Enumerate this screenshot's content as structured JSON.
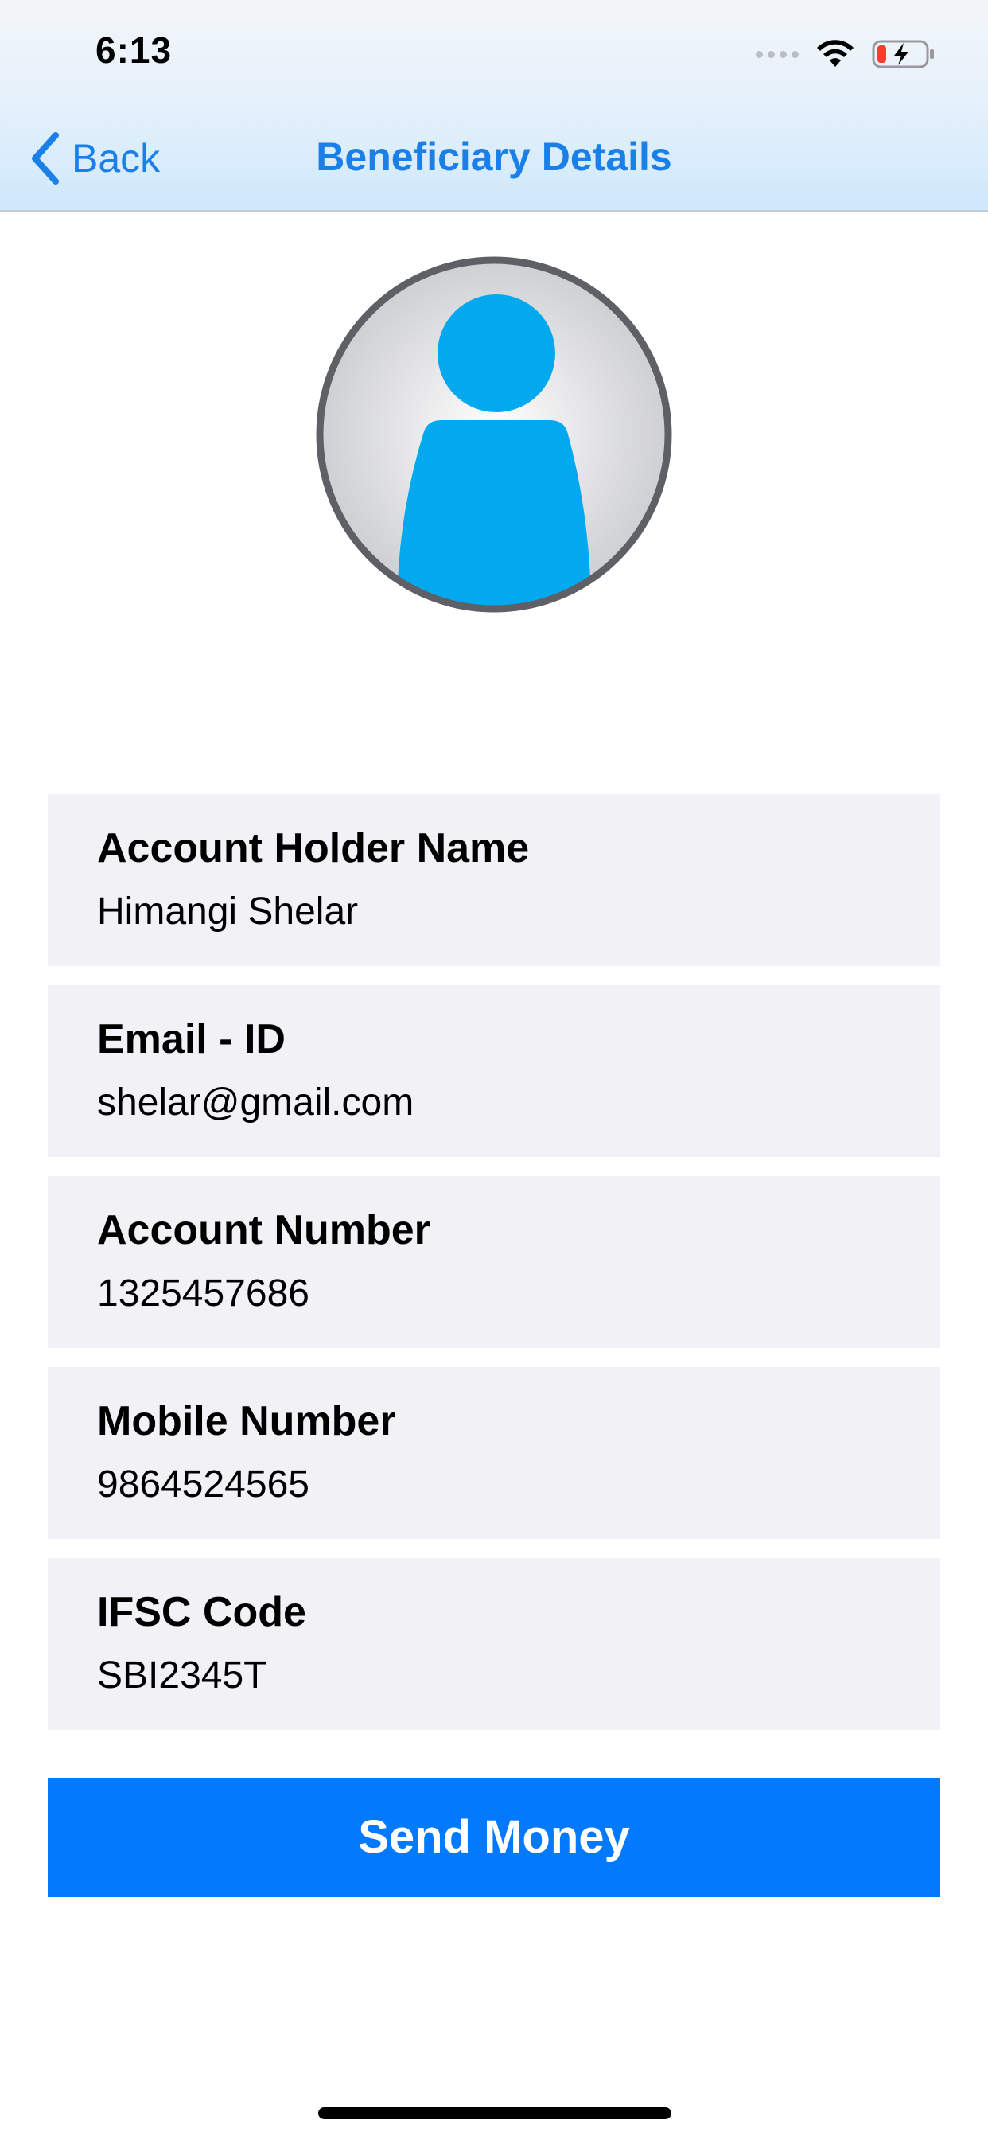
{
  "status_bar": {
    "time": "6:13",
    "icons": [
      "cellular-signal-icon",
      "wifi-icon",
      "battery-charging-icon"
    ]
  },
  "nav": {
    "back_label": "Back",
    "title": "Beneficiary Details"
  },
  "avatar": {
    "icon": "user-avatar-icon"
  },
  "details": [
    {
      "label": "Account Holder Name",
      "value": "Himangi Shelar"
    },
    {
      "label": "Email - ID",
      "value": "shelar@gmail.com"
    },
    {
      "label": "Account Number",
      "value": "1325457686"
    },
    {
      "label": "Mobile Number",
      "value": "9864524565"
    },
    {
      "label": "IFSC Code",
      "value": "SBI2345T"
    }
  ],
  "actions": {
    "send_money_label": "Send Money"
  },
  "colors": {
    "accent": "#1a80e8",
    "button": "#037afe",
    "card_background": "#f2f2f6",
    "avatar_figure": "#02a9ef",
    "avatar_ring": "#5f6066"
  }
}
